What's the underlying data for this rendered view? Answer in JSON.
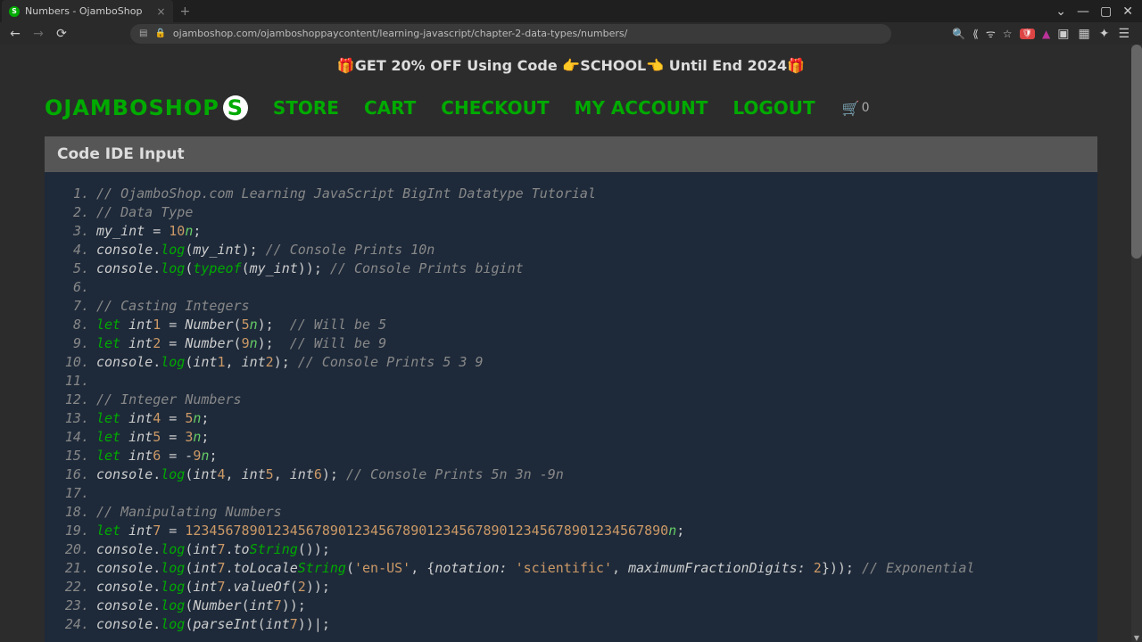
{
  "browser": {
    "tab_title": "Numbers - OjamboShop",
    "url": "ojamboshop.com/ojamboshoppaycontent/learning-javascript/chapter-2-data-types/numbers/"
  },
  "banner": "🎁GET 20% OFF Using Code 👉SCHOOL👈 Until End 2024🎁",
  "nav": {
    "logo": "OJAMBOSHOP",
    "links": [
      "STORE",
      "CART",
      "CHECKOUT",
      "MY ACCOUNT",
      "LOGOUT"
    ],
    "cart_count": "0"
  },
  "panel_header": "Code IDE Input",
  "code": {
    "lines": [
      {
        "n": "1.",
        "tokens": [
          {
            "t": "// OjamboShop.com Learning JavaScript BigInt Datatype Tutorial",
            "c": "c-cmt"
          }
        ]
      },
      {
        "n": "2.",
        "tokens": [
          {
            "t": "// Data Type",
            "c": "c-cmt"
          }
        ]
      },
      {
        "n": "3.",
        "tokens": [
          {
            "t": "my_int",
            "c": "c-id"
          },
          {
            "t": " = ",
            "c": "c-op"
          },
          {
            "t": "10",
            "c": "c-num"
          },
          {
            "t": "n",
            "c": "c-num-n"
          },
          {
            "t": ";",
            "c": "c-punc"
          }
        ]
      },
      {
        "n": "4.",
        "tokens": [
          {
            "t": "console",
            "c": "c-obj"
          },
          {
            "t": ".",
            "c": "c-dot"
          },
          {
            "t": "log",
            "c": "c-method"
          },
          {
            "t": "(",
            "c": "c-paren"
          },
          {
            "t": "my_int",
            "c": "c-id"
          },
          {
            "t": ")",
            "c": "c-paren"
          },
          {
            "t": ";",
            "c": "c-punc"
          },
          {
            "t": " // Console Prints 10n",
            "c": "c-cmt"
          }
        ]
      },
      {
        "n": "5.",
        "tokens": [
          {
            "t": "console",
            "c": "c-obj"
          },
          {
            "t": ".",
            "c": "c-dot"
          },
          {
            "t": "log",
            "c": "c-method"
          },
          {
            "t": "(",
            "c": "c-paren"
          },
          {
            "t": "typeof",
            "c": "c-typeof"
          },
          {
            "t": "(",
            "c": "c-paren"
          },
          {
            "t": "my_int",
            "c": "c-id"
          },
          {
            "t": "))",
            "c": "c-paren"
          },
          {
            "t": ";",
            "c": "c-punc"
          },
          {
            "t": " // Console Prints bigint",
            "c": "c-cmt"
          }
        ]
      },
      {
        "n": "6.",
        "tokens": []
      },
      {
        "n": "7.",
        "tokens": [
          {
            "t": "// Casting Integers",
            "c": "c-cmt"
          }
        ]
      },
      {
        "n": "8.",
        "tokens": [
          {
            "t": "let",
            "c": "c-let"
          },
          {
            "t": " int",
            "c": "c-id"
          },
          {
            "t": "1",
            "c": "c-num"
          },
          {
            "t": " = ",
            "c": "c-op"
          },
          {
            "t": "Number",
            "c": "c-Number"
          },
          {
            "t": "(",
            "c": "c-paren"
          },
          {
            "t": "5",
            "c": "c-num"
          },
          {
            "t": "n",
            "c": "c-num-n"
          },
          {
            "t": ")",
            "c": "c-paren"
          },
          {
            "t": ";",
            "c": "c-punc"
          },
          {
            "t": "  // Will be 5",
            "c": "c-cmt"
          }
        ]
      },
      {
        "n": "9.",
        "tokens": [
          {
            "t": "let",
            "c": "c-let"
          },
          {
            "t": " int",
            "c": "c-id"
          },
          {
            "t": "2",
            "c": "c-num"
          },
          {
            "t": " = ",
            "c": "c-op"
          },
          {
            "t": "Number",
            "c": "c-Number"
          },
          {
            "t": "(",
            "c": "c-paren"
          },
          {
            "t": "9",
            "c": "c-num"
          },
          {
            "t": "n",
            "c": "c-num-n"
          },
          {
            "t": ")",
            "c": "c-paren"
          },
          {
            "t": ";",
            "c": "c-punc"
          },
          {
            "t": "  // Will be 9",
            "c": "c-cmt"
          }
        ]
      },
      {
        "n": "10.",
        "tokens": [
          {
            "t": "console",
            "c": "c-obj"
          },
          {
            "t": ".",
            "c": "c-dot"
          },
          {
            "t": "log",
            "c": "c-method"
          },
          {
            "t": "(",
            "c": "c-paren"
          },
          {
            "t": "int",
            "c": "c-id"
          },
          {
            "t": "1",
            "c": "c-num"
          },
          {
            "t": ", ",
            "c": "c-punc"
          },
          {
            "t": "int",
            "c": "c-id"
          },
          {
            "t": "2",
            "c": "c-num"
          },
          {
            "t": ")",
            "c": "c-paren"
          },
          {
            "t": ";",
            "c": "c-punc"
          },
          {
            "t": " // Console Prints 5 3 9",
            "c": "c-cmt"
          }
        ]
      },
      {
        "n": "11.",
        "tokens": []
      },
      {
        "n": "12.",
        "tokens": [
          {
            "t": "// Integer Numbers",
            "c": "c-cmt"
          }
        ]
      },
      {
        "n": "13.",
        "tokens": [
          {
            "t": "let",
            "c": "c-let"
          },
          {
            "t": " int",
            "c": "c-id"
          },
          {
            "t": "4",
            "c": "c-num"
          },
          {
            "t": " = ",
            "c": "c-op"
          },
          {
            "t": "5",
            "c": "c-num"
          },
          {
            "t": "n",
            "c": "c-num-n"
          },
          {
            "t": ";",
            "c": "c-punc"
          }
        ]
      },
      {
        "n": "14.",
        "tokens": [
          {
            "t": "let",
            "c": "c-let"
          },
          {
            "t": " int",
            "c": "c-id"
          },
          {
            "t": "5",
            "c": "c-num"
          },
          {
            "t": " = ",
            "c": "c-op"
          },
          {
            "t": "3",
            "c": "c-num"
          },
          {
            "t": "n",
            "c": "c-num-n"
          },
          {
            "t": ";",
            "c": "c-punc"
          }
        ]
      },
      {
        "n": "15.",
        "tokens": [
          {
            "t": "let",
            "c": "c-let"
          },
          {
            "t": " int",
            "c": "c-id"
          },
          {
            "t": "6",
            "c": "c-num"
          },
          {
            "t": " = -",
            "c": "c-op"
          },
          {
            "t": "9",
            "c": "c-num"
          },
          {
            "t": "n",
            "c": "c-num-n"
          },
          {
            "t": ";",
            "c": "c-punc"
          }
        ]
      },
      {
        "n": "16.",
        "tokens": [
          {
            "t": "console",
            "c": "c-obj"
          },
          {
            "t": ".",
            "c": "c-dot"
          },
          {
            "t": "log",
            "c": "c-method"
          },
          {
            "t": "(",
            "c": "c-paren"
          },
          {
            "t": "int",
            "c": "c-id"
          },
          {
            "t": "4",
            "c": "c-num"
          },
          {
            "t": ", ",
            "c": "c-punc"
          },
          {
            "t": "int",
            "c": "c-id"
          },
          {
            "t": "5",
            "c": "c-num"
          },
          {
            "t": ", ",
            "c": "c-punc"
          },
          {
            "t": "int",
            "c": "c-id"
          },
          {
            "t": "6",
            "c": "c-num"
          },
          {
            "t": ")",
            "c": "c-paren"
          },
          {
            "t": ";",
            "c": "c-punc"
          },
          {
            "t": " // Console Prints 5n 3n -9n",
            "c": "c-cmt"
          }
        ]
      },
      {
        "n": "17.",
        "tokens": []
      },
      {
        "n": "18.",
        "tokens": [
          {
            "t": "// Manipulating Numbers",
            "c": "c-cmt"
          }
        ]
      },
      {
        "n": "19.",
        "tokens": [
          {
            "t": "let",
            "c": "c-let"
          },
          {
            "t": " int",
            "c": "c-id"
          },
          {
            "t": "7",
            "c": "c-num"
          },
          {
            "t": " = ",
            "c": "c-op"
          },
          {
            "t": "123456789012345678901234567890123456789012345678901234567890",
            "c": "c-num"
          },
          {
            "t": "n",
            "c": "c-num-n"
          },
          {
            "t": ";",
            "c": "c-punc"
          }
        ]
      },
      {
        "n": "20.",
        "tokens": [
          {
            "t": "console",
            "c": "c-obj"
          },
          {
            "t": ".",
            "c": "c-dot"
          },
          {
            "t": "log",
            "c": "c-method"
          },
          {
            "t": "(",
            "c": "c-paren"
          },
          {
            "t": "int",
            "c": "c-id"
          },
          {
            "t": "7",
            "c": "c-num"
          },
          {
            "t": ".",
            "c": "c-dot"
          },
          {
            "t": "to",
            "c": "c-id"
          },
          {
            "t": "String",
            "c": "c-String"
          },
          {
            "t": "())",
            "c": "c-paren"
          },
          {
            "t": ";",
            "c": "c-punc"
          }
        ]
      },
      {
        "n": "21.",
        "tokens": [
          {
            "t": "console",
            "c": "c-obj"
          },
          {
            "t": ".",
            "c": "c-dot"
          },
          {
            "t": "log",
            "c": "c-method"
          },
          {
            "t": "(",
            "c": "c-paren"
          },
          {
            "t": "int",
            "c": "c-id"
          },
          {
            "t": "7",
            "c": "c-num"
          },
          {
            "t": ".",
            "c": "c-dot"
          },
          {
            "t": "toLocale",
            "c": "c-id"
          },
          {
            "t": "String",
            "c": "c-String"
          },
          {
            "t": "(",
            "c": "c-paren"
          },
          {
            "t": "'en-US'",
            "c": "c-str"
          },
          {
            "t": ", {",
            "c": "c-punc"
          },
          {
            "t": "notation: ",
            "c": "c-id"
          },
          {
            "t": "'scientific'",
            "c": "c-str"
          },
          {
            "t": ", ",
            "c": "c-punc"
          },
          {
            "t": "maximumFractionDigits: ",
            "c": "c-id"
          },
          {
            "t": "2",
            "c": "c-num"
          },
          {
            "t": "}))",
            "c": "c-paren"
          },
          {
            "t": ";",
            "c": "c-punc"
          },
          {
            "t": " // Exponential",
            "c": "c-cmt"
          }
        ]
      },
      {
        "n": "22.",
        "tokens": [
          {
            "t": "console",
            "c": "c-obj"
          },
          {
            "t": ".",
            "c": "c-dot"
          },
          {
            "t": "log",
            "c": "c-method"
          },
          {
            "t": "(",
            "c": "c-paren"
          },
          {
            "t": "int",
            "c": "c-id"
          },
          {
            "t": "7",
            "c": "c-num"
          },
          {
            "t": ".",
            "c": "c-dot"
          },
          {
            "t": "valueOf",
            "c": "c-id"
          },
          {
            "t": "(",
            "c": "c-paren"
          },
          {
            "t": "2",
            "c": "c-num"
          },
          {
            "t": "))",
            "c": "c-paren"
          },
          {
            "t": ";",
            "c": "c-punc"
          }
        ]
      },
      {
        "n": "23.",
        "tokens": [
          {
            "t": "console",
            "c": "c-obj"
          },
          {
            "t": ".",
            "c": "c-dot"
          },
          {
            "t": "log",
            "c": "c-method"
          },
          {
            "t": "(",
            "c": "c-paren"
          },
          {
            "t": "Number",
            "c": "c-Number"
          },
          {
            "t": "(",
            "c": "c-paren"
          },
          {
            "t": "int",
            "c": "c-id"
          },
          {
            "t": "7",
            "c": "c-num"
          },
          {
            "t": "))",
            "c": "c-paren"
          },
          {
            "t": ";",
            "c": "c-punc"
          }
        ]
      },
      {
        "n": "24.",
        "tokens": [
          {
            "t": "console",
            "c": "c-obj"
          },
          {
            "t": ".",
            "c": "c-dot"
          },
          {
            "t": "log",
            "c": "c-method"
          },
          {
            "t": "(",
            "c": "c-paren"
          },
          {
            "t": "parseInt",
            "c": "c-id"
          },
          {
            "t": "(",
            "c": "c-paren"
          },
          {
            "t": "int",
            "c": "c-id"
          },
          {
            "t": "7",
            "c": "c-num"
          },
          {
            "t": "))",
            "c": "c-paren"
          },
          {
            "t": "|;",
            "c": "c-punc"
          }
        ]
      }
    ]
  }
}
